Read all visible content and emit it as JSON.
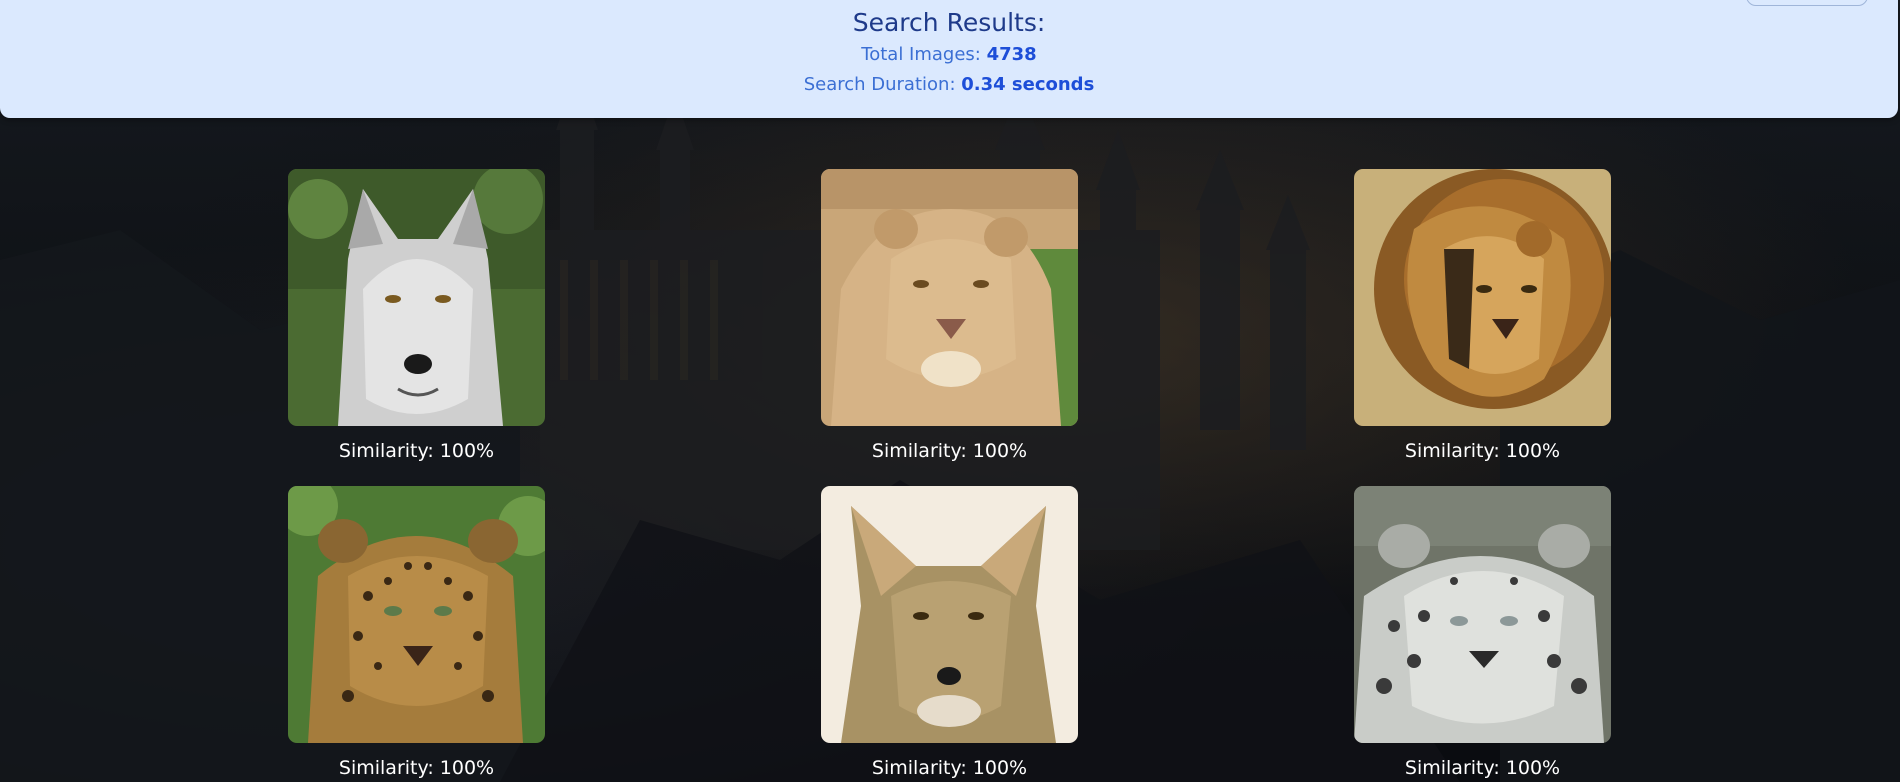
{
  "header": {
    "title": "Search Results:",
    "total_label": "Total Images: ",
    "total_value": "4738",
    "duration_label": "Search Duration: ",
    "duration_value": "0.34 seconds"
  },
  "results": [
    {
      "caption": "Similarity: 100%",
      "icon": "gray-wolf-photo"
    },
    {
      "caption": "Similarity: 100%",
      "icon": "lioness-photo"
    },
    {
      "caption": "Similarity: 100%",
      "icon": "lion-photo"
    },
    {
      "caption": "Similarity: 100%",
      "icon": "leopard-photo"
    },
    {
      "caption": "Similarity: 100%",
      "icon": "coyote-photo"
    },
    {
      "caption": "Similarity: 100%",
      "icon": "snow-leopard-photo"
    }
  ]
}
